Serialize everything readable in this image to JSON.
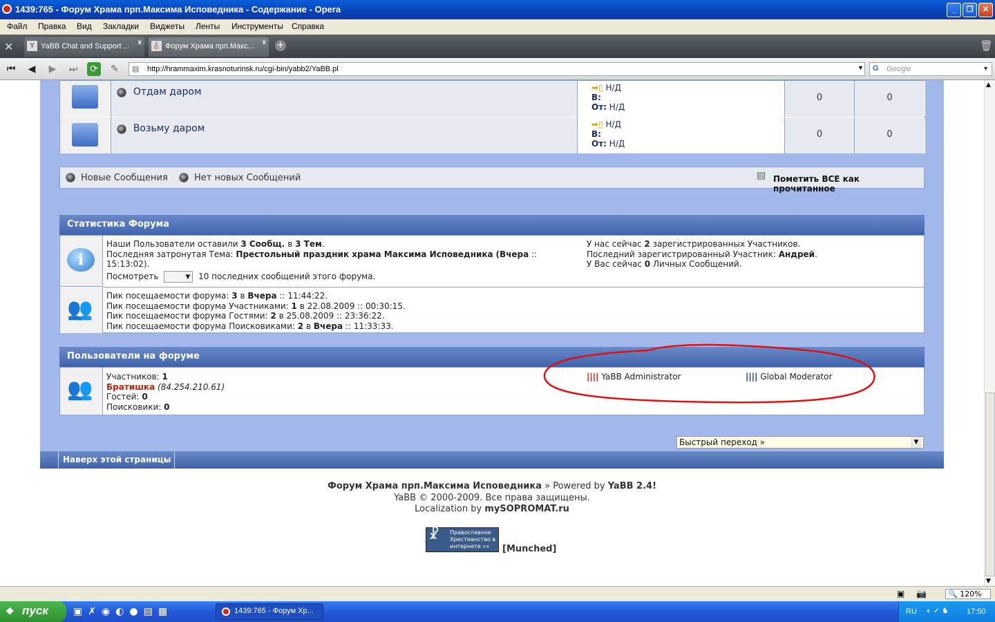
{
  "window": {
    "title": "1439:765 - Форум Храма прп.Максима Исповедника - Содержание - Opera",
    "minimize": "_",
    "restore": "❐",
    "close": "✕"
  },
  "menu": [
    "Файл",
    "Правка",
    "Вид",
    "Закладки",
    "Виджеты",
    "Ленты",
    "Инструменты",
    "Справка"
  ],
  "tabs": [
    {
      "label": "YaBB Chat and Support ...",
      "icon": "Y"
    },
    {
      "label": "Форум Храма прп.Макс...",
      "icon": "⛪"
    }
  ],
  "address": {
    "url": "http://hrammaxim.krasnoturinsk.ru/cgi-bin/yabb2/YaBB.pl",
    "search_placeholder": "Google"
  },
  "boards": [
    {
      "name": "Отдам даром",
      "last_na": "Н/Д",
      "in_label": "В:",
      "from_label": "От:",
      "from_value": "Н/Д",
      "topics": "0",
      "posts": "0"
    },
    {
      "name": "Возьму даром",
      "last_na": "Н/Д",
      "in_label": "В:",
      "from_label": "От:",
      "from_value": "Н/Д",
      "topics": "0",
      "posts": "0"
    }
  ],
  "legend": {
    "new": "Новые Сообщения",
    "no_new": "Нет новых Сообщений",
    "mark_all": "Пометить ВСЕ как прочитанное"
  },
  "stats": {
    "header": "Статистика Форума",
    "line1_a": "Наши Пользователи оставили",
    "line1_b": "3 Сообщ.",
    "line1_c": "в",
    "line1_d": "3 Тем",
    "line2_a": "Последняя затронутая Тема:",
    "line2_topic": "Престольный праздник храма Максима Исповедника",
    "line2_when": "(Вчера",
    "line2_time": ":: 15:13:02).",
    "line3_a": "Посмотреть",
    "line3_b": "10 последних сообщений этого форума.",
    "right1_a": "У нас сейчас",
    "right1_b": "2",
    "right1_c": "зарегистрированных Участников.",
    "right2_a": "Последний зарегистрированный Участник:",
    "right2_b": "Андрей",
    "right3_a": "У Вас сейчас",
    "right3_b": "0",
    "right3_c": "Личных Сообщений.",
    "peak1": "Пик посещаемости форума:",
    "peak1_v": "3",
    "peak1_in": "в",
    "peak1_when": "Вчера",
    "peak1_t": ":: 11:44:22.",
    "peak2": "Пик посещаемости форума Участниками:",
    "peak2_v": "1",
    "peak2_t": "в 22.08.2009 :: 00:30:15.",
    "peak3": "Пик посещаемости форума Гостями:",
    "peak3_v": "2",
    "peak3_t": "в 25.08.2009 :: 23:36:22.",
    "peak4": "Пик посещаемости форума Поисковиками:",
    "peak4_v": "2",
    "peak4_in": "в",
    "peak4_when": "Вчера",
    "peak4_t": ":: 11:33:33."
  },
  "online": {
    "header": "Пользователи на форуме",
    "members_label": "Участников:",
    "members_value": "1",
    "user": "Братишка",
    "user_ip": "(84.254.210.61)",
    "guests_label": "Гостей:",
    "guests_value": "0",
    "bots_label": "Поисковики:",
    "bots_value": "0",
    "group_admin": "YaBB Administrator",
    "group_mod": "Global Moderator",
    "admin_color": "#e01010",
    "mod_color": "#1030c0"
  },
  "jump": {
    "label": "Быстрый переход »"
  },
  "top_link": "Наверх этой страницы",
  "footer": {
    "line1_a": "Форум Храма прп.Максима Исповедника",
    "line1_b": "» Powered by",
    "line1_c": "YaBB 2.4!",
    "line2": "YaBB © 2000-2009. Все права защищены.",
    "line3_a": "Localization by",
    "line3_b": "mySOPROMAT.ru",
    "banner": "Православное Христианство в интернете »»",
    "munched": "[Munched]"
  },
  "status": {
    "zoom": "120%"
  },
  "taskbar": {
    "start": "пуск",
    "task": "1439:765 - Форум Хр...",
    "lang": "RU",
    "clock": "17:50"
  }
}
